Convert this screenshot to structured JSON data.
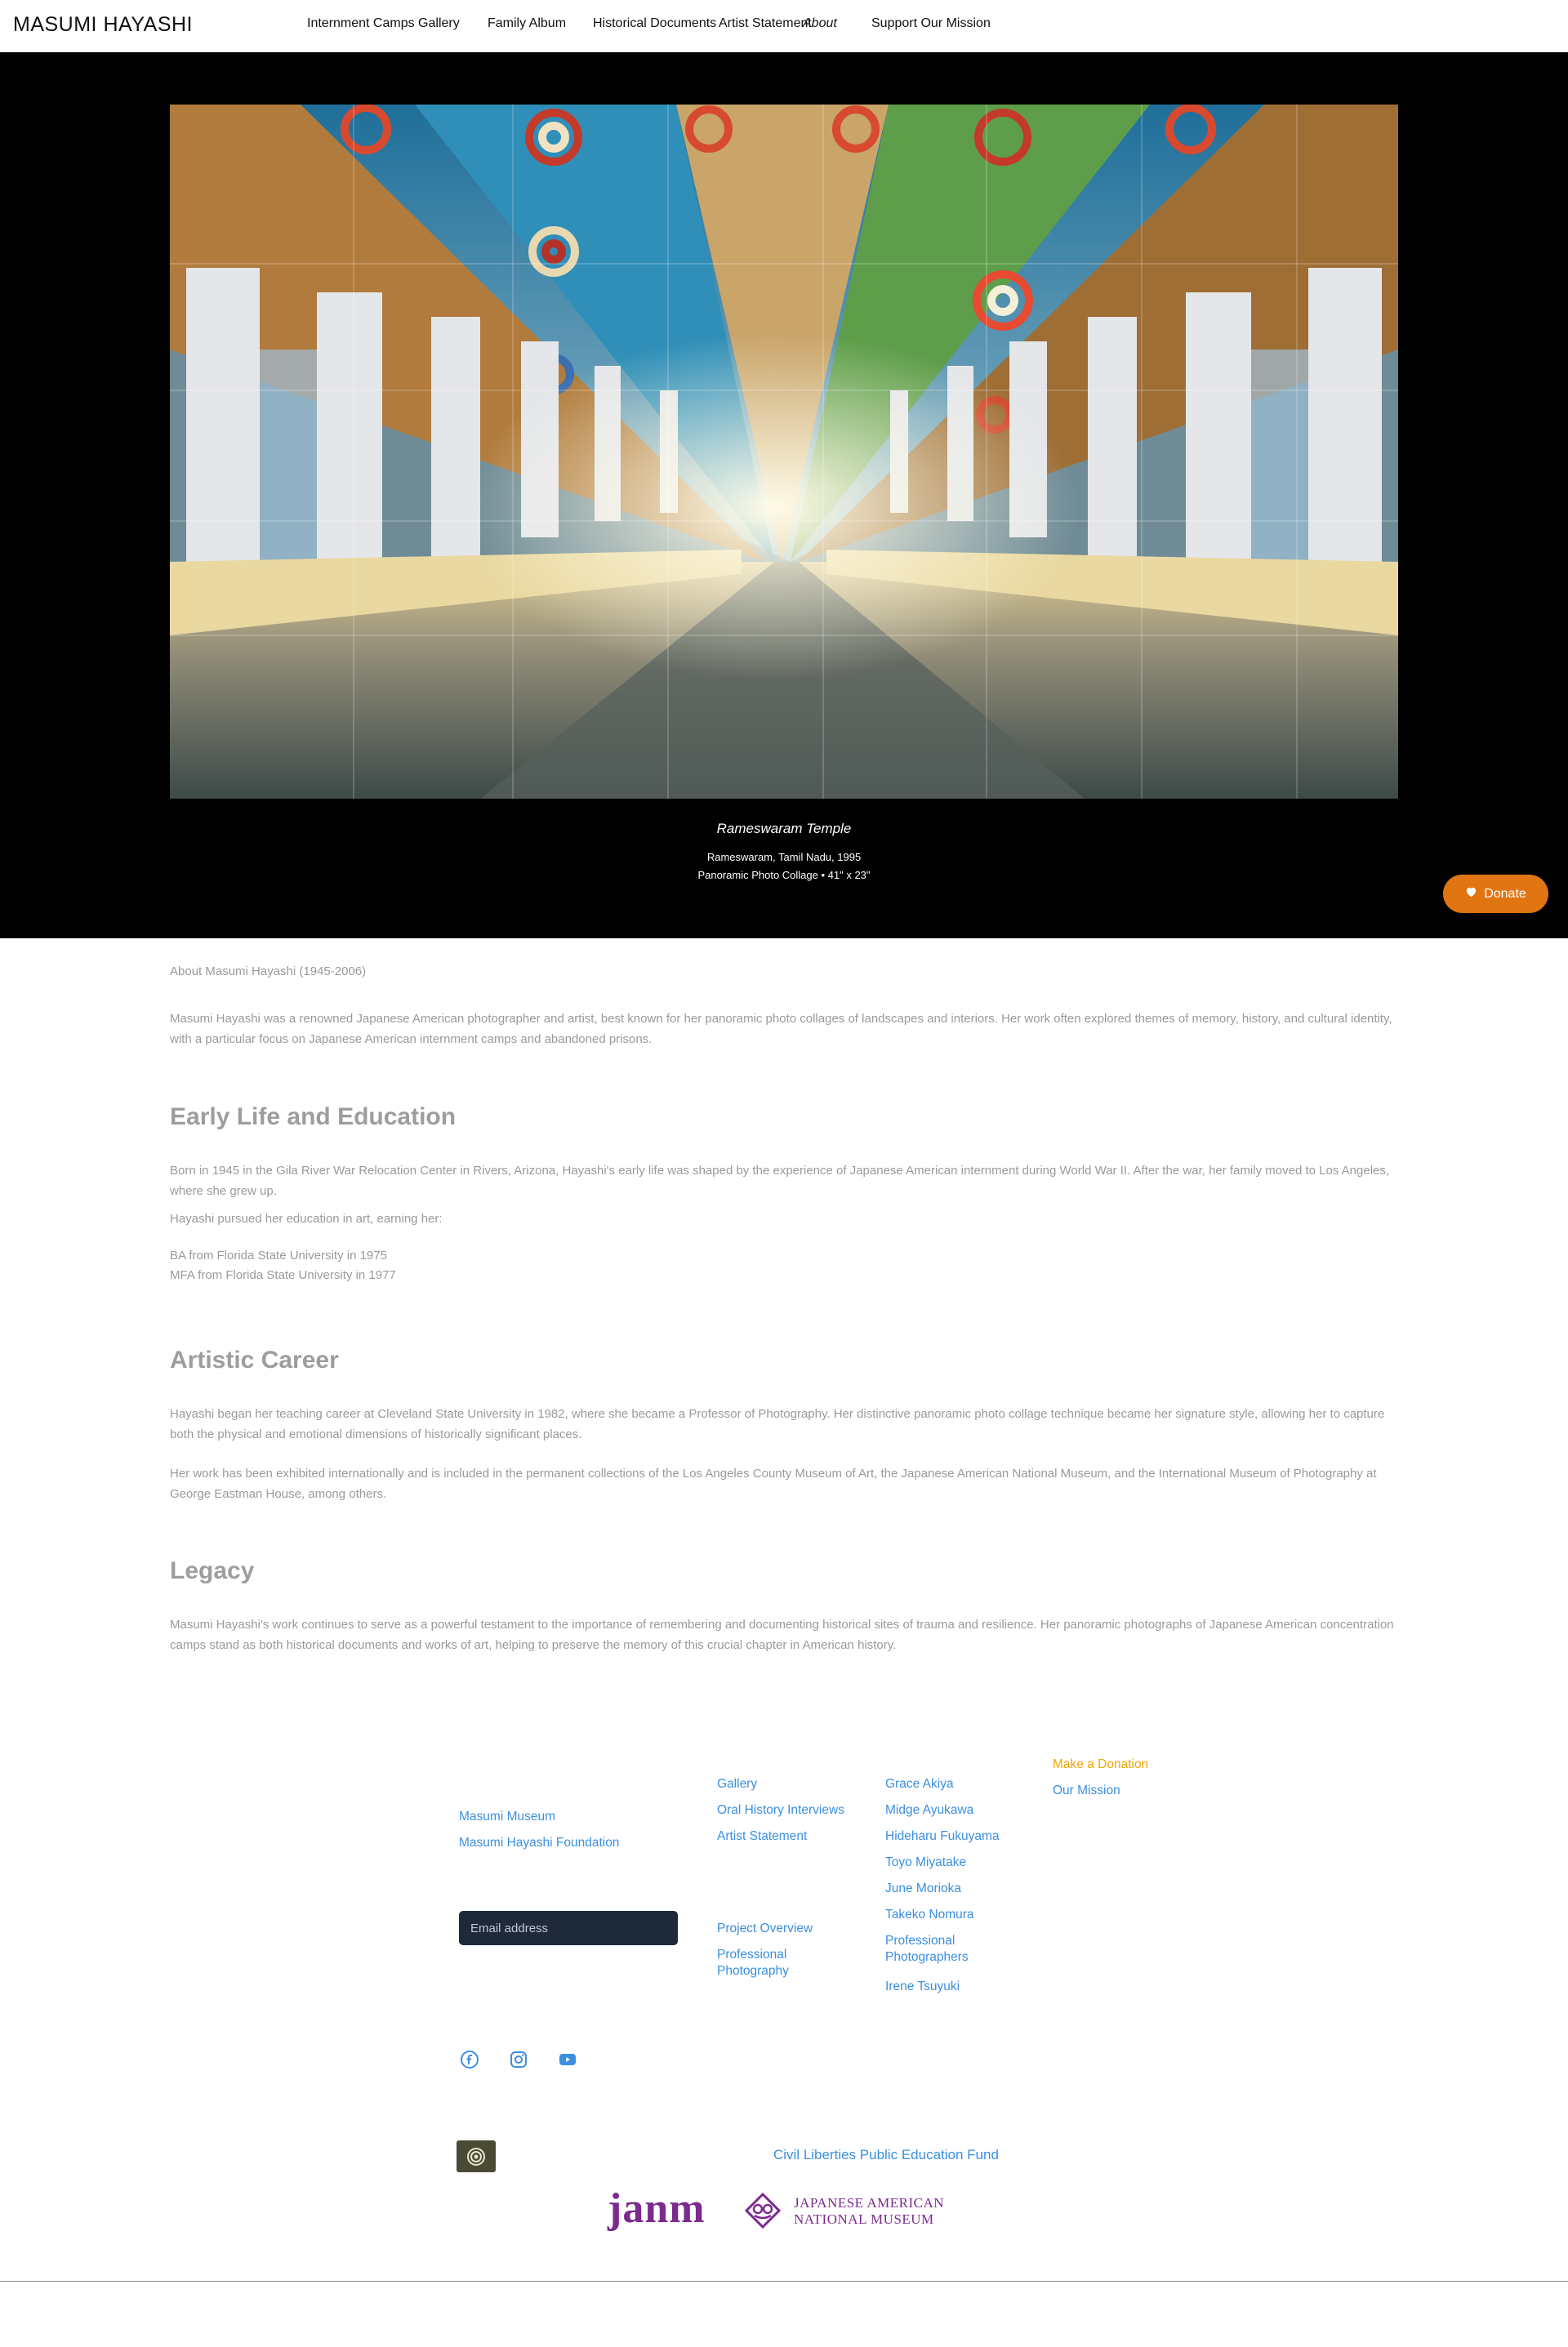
{
  "header": {
    "brand": "MASUMI HAYASHI",
    "nav": [
      {
        "label": "Internment Camps Gallery"
      },
      {
        "label": "Family Album"
      },
      {
        "label": "Historical Documents"
      },
      {
        "label": "Artist Statement"
      },
      {
        "label": "About"
      },
      {
        "label": "Support Our Mission"
      }
    ]
  },
  "hero": {
    "caption_title": "Rameswaram Temple",
    "caption_place": "Rameswaram, Tamil Nadu, 1995",
    "caption_medium": "Panoramic Photo Collage • 41\" x 23\"",
    "donate_label": "Donate",
    "donate_icon": "heart-icon",
    "donate_color": "#e07512"
  },
  "content": {
    "intro_title": "About Masumi Hayashi (1945-2006)",
    "intro_body": "Masumi Hayashi was a renowned Japanese American photographer and artist, best known for her panoramic photo collages of landscapes and interiors. Her work often explored themes of memory, history, and cultural identity, with a particular focus on Japanese American internment camps and abandoned prisons.",
    "early_heading": "Early Life and Education",
    "early_p1": "Born in 1945 in the Gila River War Relocation Center in Rivers, Arizona, Hayashi's early life was shaped by the experience of Japanese American internment during World War II. After the war, her family moved to Los Angeles, where she grew up.",
    "early_p2": "Hayashi pursued her education in art, earning her:",
    "degree_1": "BA from Florida State University in 1975",
    "degree_2": "MFA from Florida State University in 1977",
    "career_heading": "Artistic Career",
    "career_p1": "Hayashi began her teaching career at Cleveland State University in 1982, where she became a Professor of Photography. Her distinctive panoramic photo collage technique became her signature style, allowing her to capture both the physical and emotional dimensions of historically significant places.",
    "career_p2": "Her work has been exhibited internationally and is included in the permanent collections of the Los Angeles County Museum of Art, the Japanese American National Museum, and the International Museum of Photography at George Eastman House, among others.",
    "legacy_heading": "Legacy",
    "legacy_p1": "Masumi Hayashi's work continues to serve as a powerful testament to the importance of remembering and documenting historical sites of trauma and resilience. Her panoramic photographs of Japanese American concentration camps stand as both historical documents and works of art, helping to preserve the memory of this crucial chapter in American history."
  },
  "footer": {
    "col1": [
      "Masumi Museum",
      "Masumi Hayashi Foundation"
    ],
    "email_placeholder": "Email address",
    "col2a": [
      "Gallery",
      "Oral History Interviews",
      "Artist Statement"
    ],
    "col2b": [
      "Project Overview",
      "Professional Photography"
    ],
    "col3": [
      "Grace Akiya",
      "Midge Ayukawa",
      "Hideharu Fukuyama",
      "Toyo Miyatake",
      "June Morioka",
      "Takeko Nomura",
      "Professional Photographers",
      "Irene Tsuyuki"
    ],
    "col4_highlight": "Make a Donation",
    "col4": [
      "Our Mission"
    ],
    "highlight_color": "#f0a500",
    "link_color": "#3b8fe0",
    "social_icons": [
      "facebook-icon",
      "instagram-icon",
      "youtube-icon"
    ],
    "clpef_label": "Civil Liberties Public Education Fund",
    "janm_word": "janm",
    "janm_line1": "JAPANESE AMERICAN",
    "janm_line2": "NATIONAL MUSEUM",
    "janm_color": "#7b2a8e"
  }
}
